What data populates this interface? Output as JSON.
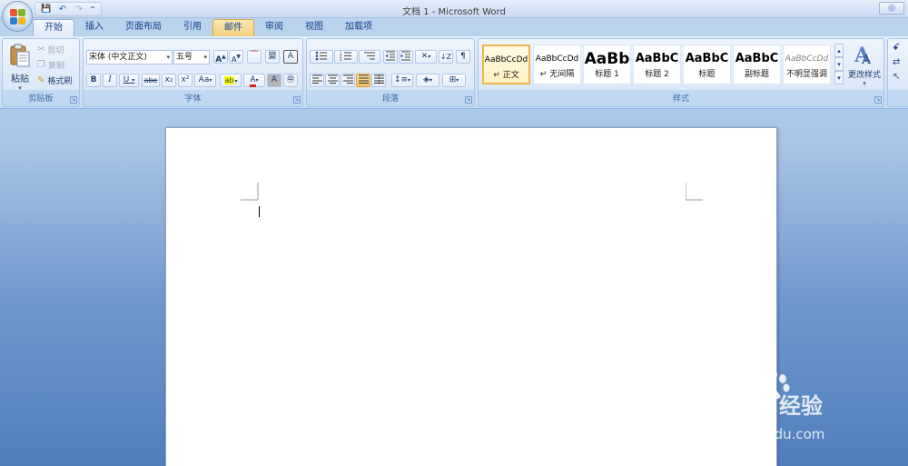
{
  "window": {
    "title": "文档 1 - Microsoft Word",
    "help_label": "◎"
  },
  "qat": {
    "save_icon": "💾",
    "undo_icon": "↶",
    "redo_icon": "↷",
    "customize_icon": "⁼"
  },
  "tabs": [
    {
      "label": "开始",
      "active": true
    },
    {
      "label": "插入"
    },
    {
      "label": "页面布局"
    },
    {
      "label": "引用"
    },
    {
      "label": "邮件"
    },
    {
      "label": "审阅"
    },
    {
      "label": "视图"
    },
    {
      "label": "加载项"
    }
  ],
  "clipboard": {
    "group_label": "剪贴板",
    "paste_label": "粘贴",
    "cut_label": "剪切",
    "copy_label": "复制",
    "format_painter_label": "格式刷"
  },
  "font": {
    "group_label": "字体",
    "font_name": "宋体 (中文正文)",
    "font_size": "五号",
    "grow_label": "A",
    "shrink_label": "A",
    "clear_label": "⁀",
    "phonetic_label": "變",
    "border_label": "A",
    "bold": "B",
    "italic": "I",
    "underline": "U",
    "strike": "abe",
    "subscript": "x₂",
    "superscript": "x²",
    "change_case": "Aa",
    "highlight_label": "ab",
    "font_color_label": "A",
    "shading_label": "A",
    "enclose_label": "㊥"
  },
  "paragraph": {
    "group_label": "段落"
  },
  "styles": {
    "group_label": "样式",
    "items": [
      {
        "sample": "AaBbCcDd",
        "name": "↵ 正文",
        "selected": true
      },
      {
        "sample": "AaBbCcDd",
        "name": "↵ 无间隔"
      },
      {
        "sample": "AaBb",
        "name": "标题 1"
      },
      {
        "sample": "AaBbC",
        "name": "标题 2"
      },
      {
        "sample": "AaBbC",
        "name": "标题"
      },
      {
        "sample": "AaBbC",
        "name": "副标题"
      },
      {
        "sample": "AaBbCcDd",
        "name": "不明显强调"
      }
    ],
    "change_styles_label": "更改样式"
  },
  "colors": {
    "accent": "#15428b",
    "selected_style_border": "#f3b54b",
    "highlight_yellow": "#ffff00",
    "font_red": "#e02020"
  },
  "watermark": {
    "logo": "Bai",
    "logo_tail": "du",
    "brand_cn": "经验",
    "url": "jingyan.baidu.com"
  }
}
